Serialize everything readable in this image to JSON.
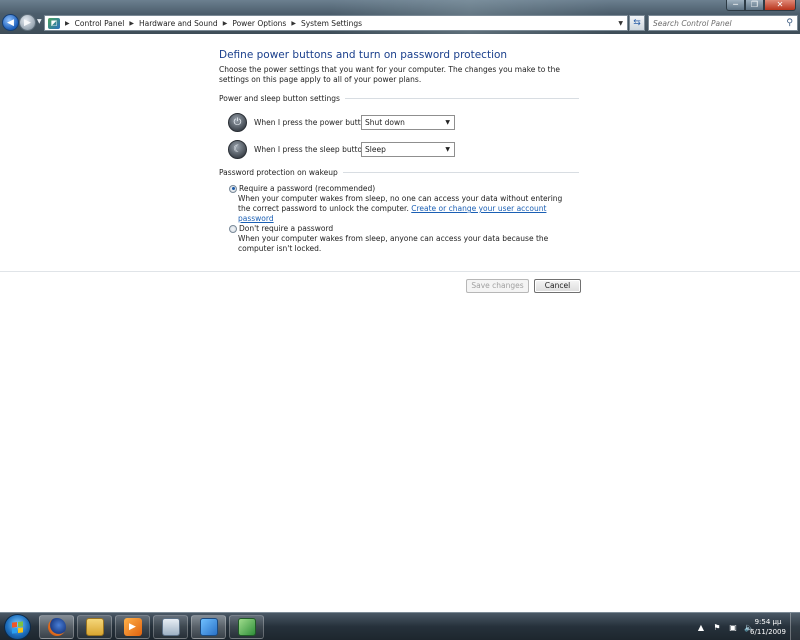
{
  "window": {
    "controls": {
      "minimize": "─",
      "maximize": "❐",
      "close": "✕"
    }
  },
  "nav": {
    "back_glyph": "◀",
    "forward_glyph": "▶",
    "recent_glyph": "▼"
  },
  "addressbar": {
    "icon": "control-panel-icon",
    "breadcrumbs": [
      "Control Panel",
      "Hardware and Sound",
      "Power Options",
      "System Settings"
    ],
    "separator": "▶",
    "dropdown_glyph": "▼",
    "refresh_glyph": "⇆"
  },
  "search": {
    "placeholder": "Search Control Panel",
    "icon": "search-icon"
  },
  "page": {
    "title": "Define power buttons and turn on password protection",
    "description": "Choose the power settings that you want for your computer. The changes you make to the settings on this page apply to all of your power plans.",
    "power_sleep_group": {
      "header": "Power and sleep button settings",
      "power_button": {
        "label": "When I press the power button:",
        "value": "Shut down",
        "icon": "power-icon"
      },
      "sleep_button": {
        "label": "When I press the sleep button:",
        "value": "Sleep",
        "icon": "sleep-moon-icon"
      }
    },
    "password_group": {
      "header": "Password protection on wakeup",
      "require": {
        "label": "Require a password (recommended)",
        "checked": true,
        "description": "When your computer wakes from sleep, no one can access your data without entering the correct password to unlock the computer.",
        "link": "Create or change your user account password"
      },
      "dont_require": {
        "label": "Don't require a password",
        "checked": false,
        "description": "When your computer wakes from sleep, anyone can access your data because the computer isn't locked."
      }
    },
    "buttons": {
      "save": "Save changes",
      "cancel": "Cancel"
    }
  },
  "taskbar": {
    "apps": [
      "firefox-icon",
      "windows-explorer-icon",
      "media-player-icon",
      "folder-icon",
      "control-panel-icon",
      "control-panel-window-icon"
    ],
    "tray_icons": [
      "show-hidden-icons-arrow",
      "flag-icon",
      "network-icon",
      "volume-icon"
    ],
    "tray_glyphs": {
      "arrow": "▲",
      "flag": "⚑",
      "network": "▣",
      "volume": "🔈"
    },
    "time": "9:54 μμ",
    "date": "6/11/2009"
  },
  "colors": {
    "title_blue": "#1a3f8c",
    "link_blue": "#1a5fb4",
    "taskbar": "#26313b"
  }
}
